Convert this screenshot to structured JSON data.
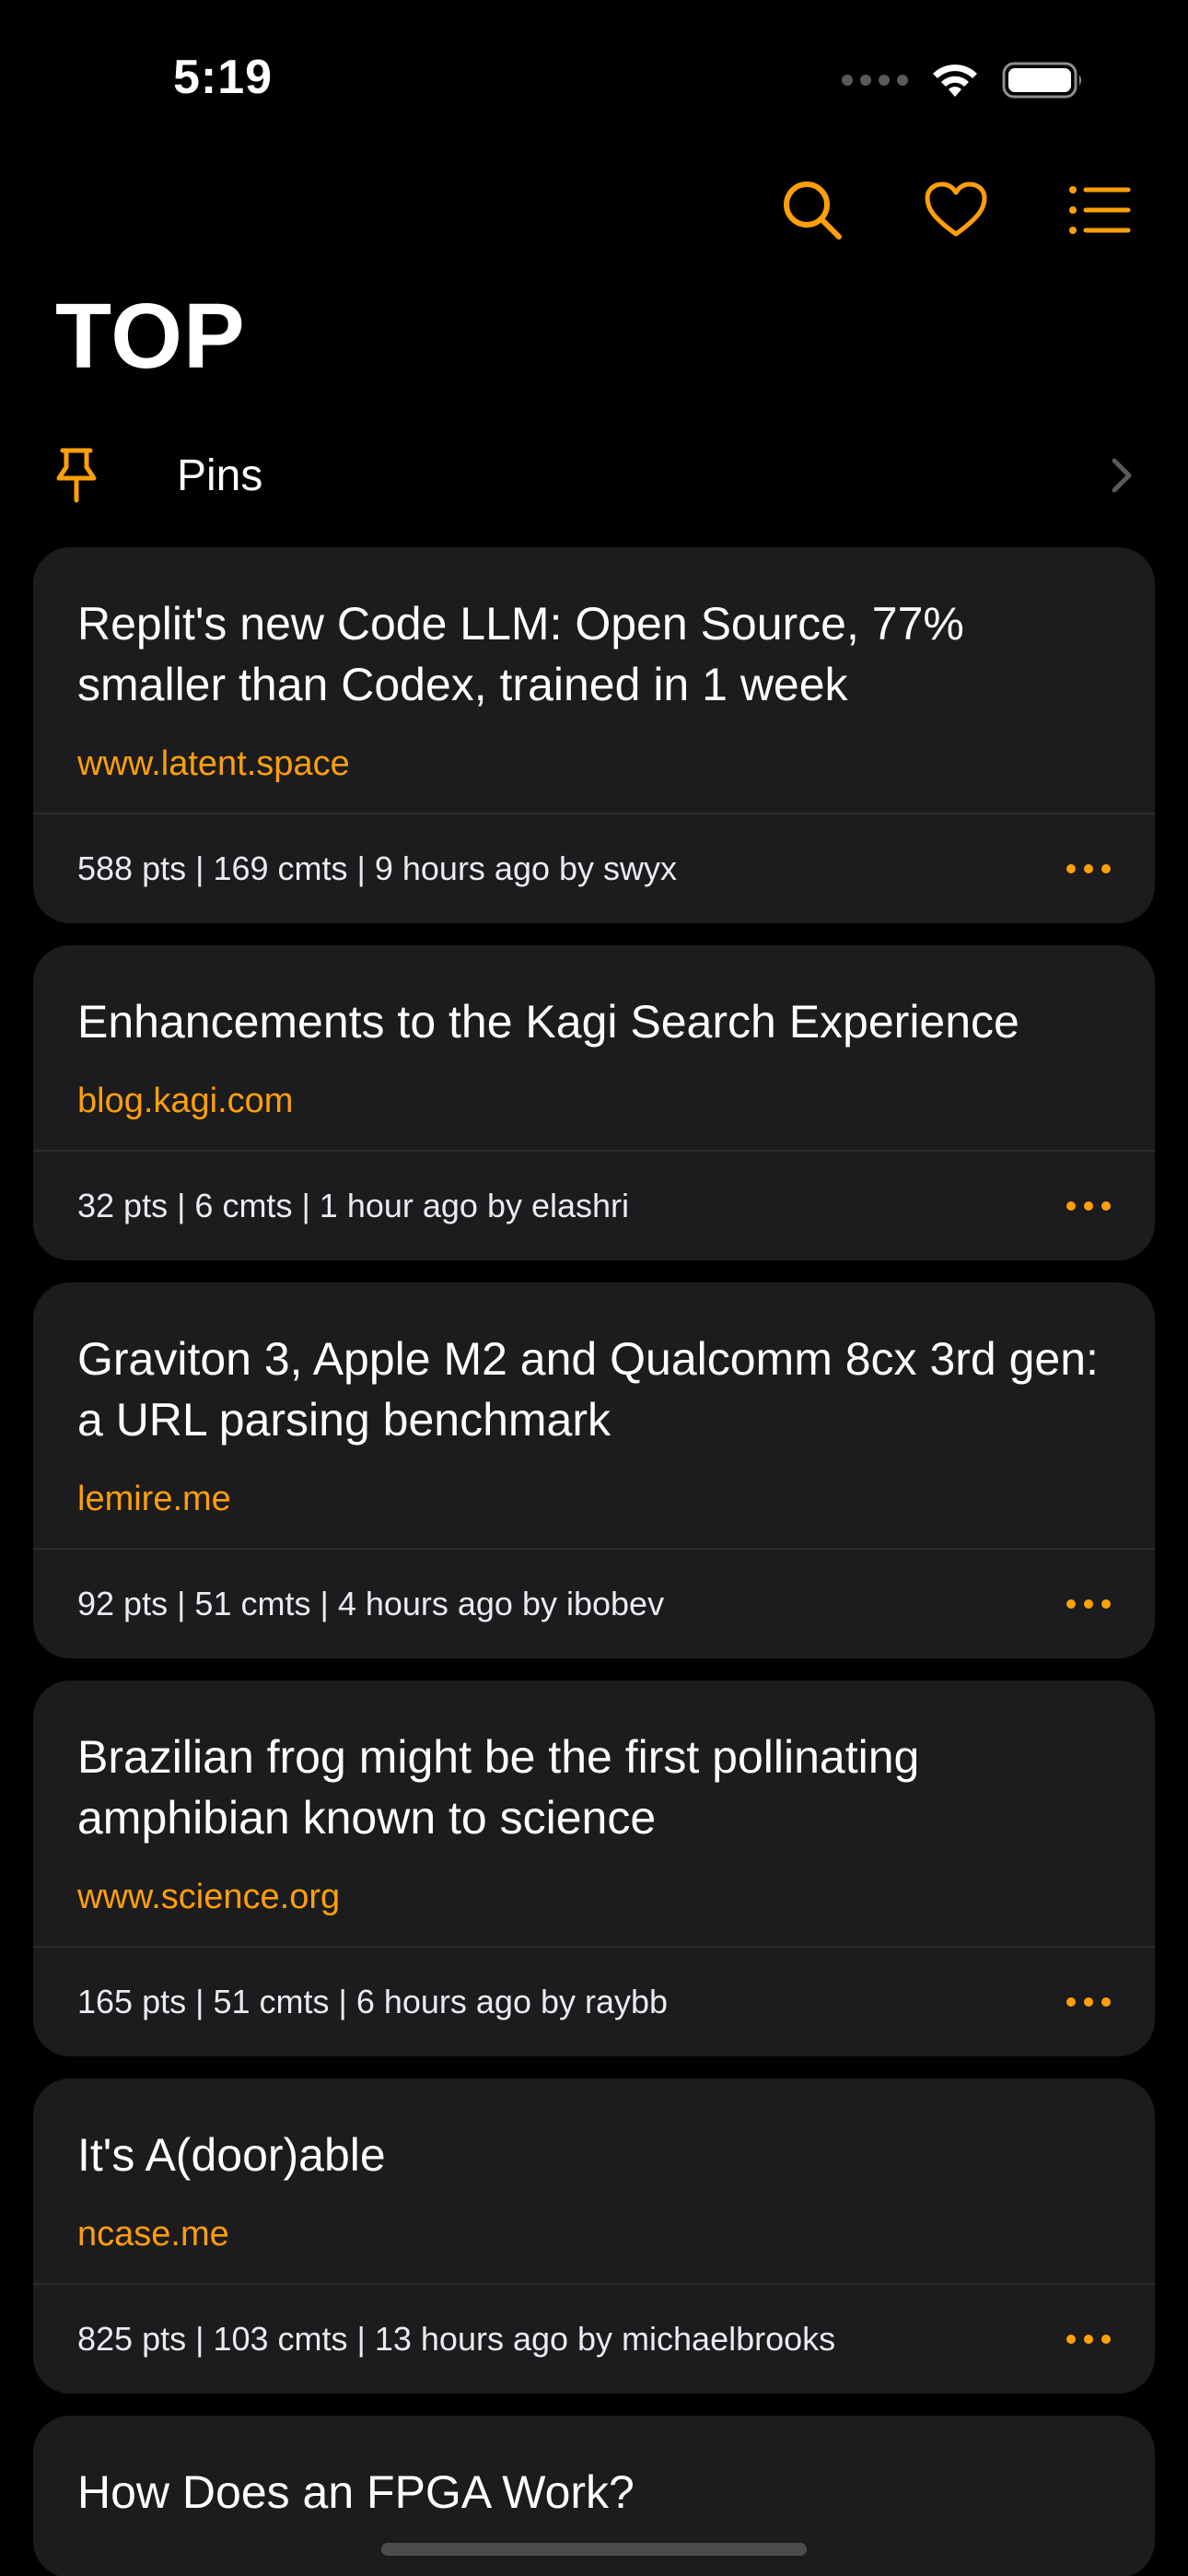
{
  "status": {
    "time": "5:19"
  },
  "header": {
    "title": "TOP",
    "accent": "#FF9F0A",
    "actions": [
      "search-icon",
      "heart-icon",
      "list-icon"
    ]
  },
  "pins": {
    "label": "Pins"
  },
  "stories": [
    {
      "title": "Replit's new Code LLM: Open Source, 77% smaller than Codex, trained in 1 week",
      "domain": "www.latent.space",
      "meta": "588 pts | 169 cmts | 9 hours ago by swyx"
    },
    {
      "title": "Enhancements to the Kagi Search Experience",
      "domain": "blog.kagi.com",
      "meta": "32 pts | 6 cmts | 1 hour ago by elashri"
    },
    {
      "title": "Graviton 3, Apple M2 and Qualcomm 8cx 3rd gen: a URL parsing benchmark",
      "domain": "lemire.me",
      "meta": "92 pts | 51 cmts | 4 hours ago by ibobev"
    },
    {
      "title": "Brazilian frog might be the first pollinating amphibian known to science",
      "domain": "www.science.org",
      "meta": "165 pts | 51 cmts | 6 hours ago by raybb"
    },
    {
      "title": "It's A(door)able",
      "domain": "ncase.me",
      "meta": "825 pts | 103 cmts | 13 hours ago by michaelbrooks"
    },
    {
      "title": "How Does an FPGA Work?",
      "domain": "",
      "meta": ""
    }
  ]
}
